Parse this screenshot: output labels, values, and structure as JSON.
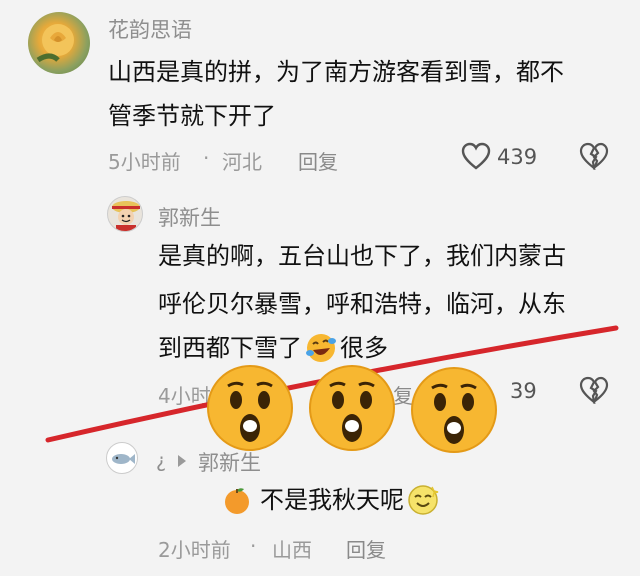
{
  "comment1": {
    "username": "花韵思语",
    "line1": "山西是真的拼，为了南方游客看到雪，都不",
    "line2": "管季节就下开了",
    "time": "5小时前",
    "dot": "·",
    "location": "河北",
    "reply_label": "回复",
    "likes": "439"
  },
  "reply1": {
    "username": "郭新生",
    "line1": "是真的啊，五台山也下了，我们内蒙古",
    "line2": "呼伦贝尔暴雪，呼和浩特，临河，从东",
    "line3_before": "到西都下雪了",
    "line3_after": "很多",
    "time": "4小时",
    "reply_label": "复",
    "likes": "39"
  },
  "reply2": {
    "username_prefix": "¿",
    "username": "郭新生",
    "text": "不是我秋天呢",
    "time": "2小时前",
    "dot": "·",
    "location": "山西",
    "reply_label": "回复"
  },
  "colors": {
    "strike_line": "#d6262b",
    "emoji_yellow": "#f7b731"
  },
  "icons": [
    "heart-icon",
    "broken-heart-icon",
    "play-arrow-icon",
    "laughing-emoji-icon",
    "orange-emoji-icon",
    "smiling-emoji-icon",
    "surprised-emoji-icon"
  ]
}
